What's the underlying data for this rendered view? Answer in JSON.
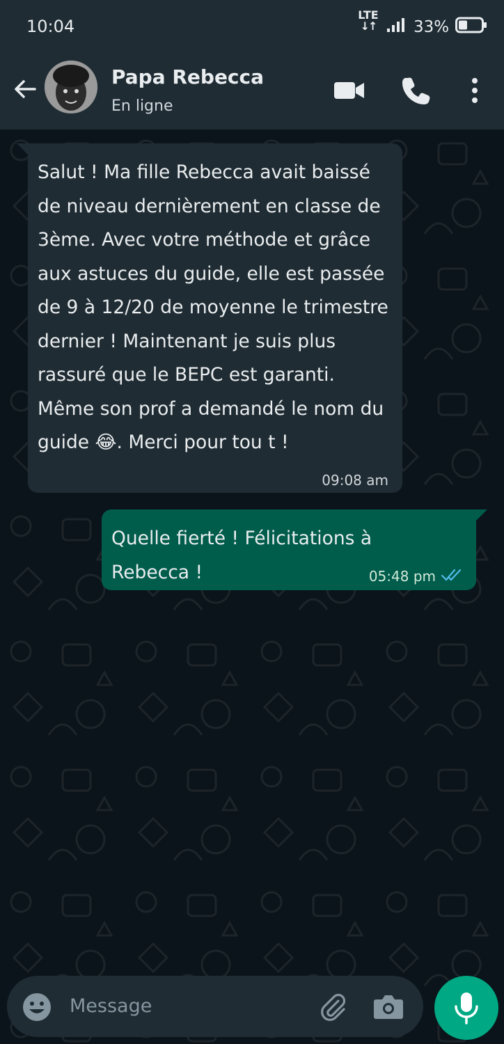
{
  "status_bar": {
    "time": "10:04",
    "network": "LTE",
    "battery": "33%"
  },
  "header": {
    "contact_name": "Papa Rebecca",
    "contact_status": "En ligne",
    "icons": [
      "back-arrow-icon",
      "video-call-icon",
      "voice-call-icon",
      "more-options-icon"
    ]
  },
  "messages": [
    {
      "direction": "incoming",
      "text_before_emoji": " Salut ! Ma fille Rebecca avait baissé de niveau dernièrement en classe de 3ème. Avec votre méthode et grâce aux astuces du guide, elle est passée de 9 à 12/20 de moyenne le trimestre dernier ! Maintenant je suis plus rassuré que le BEPC est garanti. Même son prof a demandé le nom du guide ",
      "emoji": "😂",
      "text_after_emoji": ". Merci pour tou t !",
      "time": "09:08 am"
    },
    {
      "direction": "outgoing",
      "text": " Quelle fierté ! Félicitations à Rebecca !",
      "time": "05:48 pm",
      "status": "read"
    }
  ],
  "composer": {
    "placeholder": "Message",
    "icons": [
      "emoji-icon",
      "attach-icon",
      "camera-icon",
      "microphone-icon"
    ]
  },
  "colors": {
    "background": "#0b141a",
    "header": "#1f2c34",
    "incoming_bubble": "#202c33",
    "outgoing_bubble": "#005c4b",
    "accent": "#00a884",
    "read_ticks": "#53bdeb"
  }
}
